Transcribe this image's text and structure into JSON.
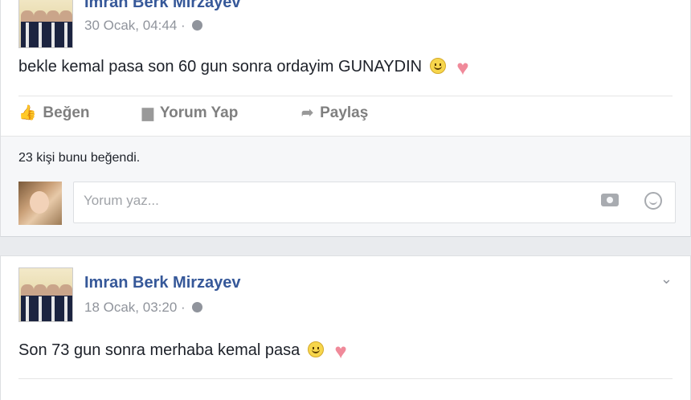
{
  "post1": {
    "author": "Imran Berk Mirzayev",
    "date": "30 Ocak, 04:44",
    "separator": "·",
    "text": "bekle kemal pasa son 60 gun sonra ordayim GUNAYDIN",
    "actions": {
      "like": "Beğen",
      "comment": "Yorum Yap",
      "share": "Paylaş"
    },
    "likes": "23 kişi bunu beğendi.",
    "comment_placeholder": "Yorum yaz..."
  },
  "post2": {
    "author": "Imran Berk Mirzayev",
    "date": "18 Ocak, 03:20",
    "separator": "·",
    "text": "Son 73 gun sonra merhaba kemal pasa"
  },
  "icons": {
    "like": "thumbs-up-icon",
    "comment": "speech-bubble-icon",
    "share": "share-arrow-icon",
    "privacy": "globe-icon",
    "camera": "camera-icon",
    "emoji": "emoji-icon",
    "menu": "chevron-down-icon"
  },
  "colors": {
    "name": "#365899",
    "meta": "#90949c",
    "background": "#e9ebee"
  }
}
